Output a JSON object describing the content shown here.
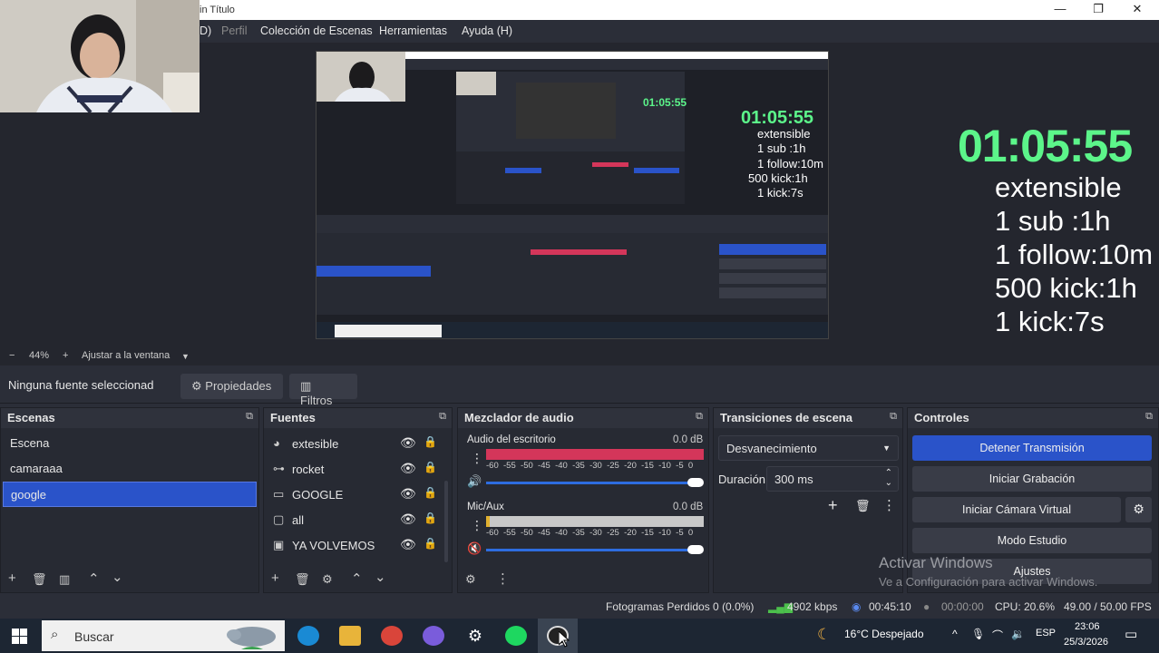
{
  "window": {
    "title": "in Título",
    "controls": [
      "—",
      "❐",
      "✕"
    ]
  },
  "menu": [
    {
      "label": "D)",
      "dim": false
    },
    {
      "label": "Perfil",
      "dim": true
    },
    {
      "label": "Colección de Escenas",
      "dim": false
    },
    {
      "label": "Herramientas",
      "dim": false
    },
    {
      "label": "Ayuda (H)",
      "dim": false
    }
  ],
  "overlay": {
    "timer": "01:05:55",
    "lines": [
      "extensible",
      "1 sub :1h",
      "1 follow:10m",
      "500 kick:1h",
      "1 kick:7s"
    ]
  },
  "zoom": {
    "minus": "−",
    "value": "44%",
    "plus": "+",
    "fit": "Ajustar a la ventana"
  },
  "source_bar": {
    "none_selected": "Ninguna fuente seleccionad",
    "properties": "Propiedades",
    "filters": "Filtros"
  },
  "scenes": {
    "title": "Escenas",
    "items": [
      {
        "label": "Escena",
        "selected": false
      },
      {
        "label": "camaraaa",
        "selected": false
      },
      {
        "label": "google",
        "selected": true
      }
    ]
  },
  "sources": {
    "title": "Fuentes",
    "items": [
      {
        "label": "extesible",
        "icon": "palette-icon"
      },
      {
        "label": "rocket",
        "icon": "gamepad-icon"
      },
      {
        "label": "GOOGLE",
        "icon": "window-icon"
      },
      {
        "label": "all",
        "icon": "monitor-icon"
      },
      {
        "label": "YA VOLVEMOS",
        "icon": "image-icon"
      }
    ]
  },
  "mixer": {
    "title": "Mezclador de audio",
    "tracks": [
      {
        "name": "Audio del escritorio",
        "db": "0.0 dB",
        "level": 1.0,
        "muted": false
      },
      {
        "name": "Mic/Aux",
        "db": "0.0 dB",
        "level": 0.0,
        "muted": true
      }
    ],
    "ticks": [
      "-60",
      "-55",
      "-50",
      "-45",
      "-40",
      "-35",
      "-30",
      "-25",
      "-20",
      "-15",
      "-10",
      "-5",
      "0"
    ]
  },
  "transitions": {
    "title": "Transiciones de escena",
    "selected": "Desvanecimiento",
    "duration_label": "Duración",
    "duration_value": "300 ms"
  },
  "controls": {
    "title": "Controles",
    "stop_stream": "Detener Transmisión",
    "start_recording": "Iniciar Grabación",
    "virtual_cam": "Iniciar Cámara Virtual",
    "studio_mode": "Modo Estudio",
    "settings": "Ajustes"
  },
  "watermark": {
    "title": "Activar Windows",
    "subtitle": "Ve a Configuración para activar Windows."
  },
  "status": {
    "dropped_frames": "Fotogramas Perdidos 0 (0.0%)",
    "bitrate": "4902 kbps",
    "stream_time": "00:45:10",
    "rec_time": "00:00:00",
    "cpu": "CPU: 20.6%",
    "fps": "49.00 / 50.00 FPS"
  },
  "taskbar": {
    "search_placeholder": "Buscar",
    "weather": "16°C  Despejado",
    "lang": "ESP",
    "time": "23:06",
    "date": "25/3/2026"
  },
  "colors": {
    "accent": "#2a53c9",
    "timer": "#5cf58a",
    "meter_red": "#d4365a"
  }
}
